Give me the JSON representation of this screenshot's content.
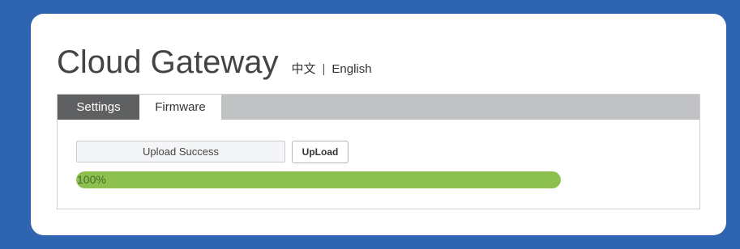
{
  "header": {
    "title": "Cloud Gateway",
    "lang_chinese": "中文",
    "lang_separator": "|",
    "lang_english": "English"
  },
  "tabs": [
    {
      "label": "Settings",
      "active": false
    },
    {
      "label": "Firmware",
      "active": true
    }
  ],
  "firmware": {
    "status_value": "Upload Success",
    "upload_label": "UpLoad",
    "progress_percent": 100,
    "progress_label": "100%"
  },
  "colors": {
    "background": "#2f64b0",
    "tab_active": "#ffffff",
    "tab_inactive": "#5f6062",
    "tabbar": "#c1c2c4",
    "progress_fill": "#8dc14f"
  }
}
